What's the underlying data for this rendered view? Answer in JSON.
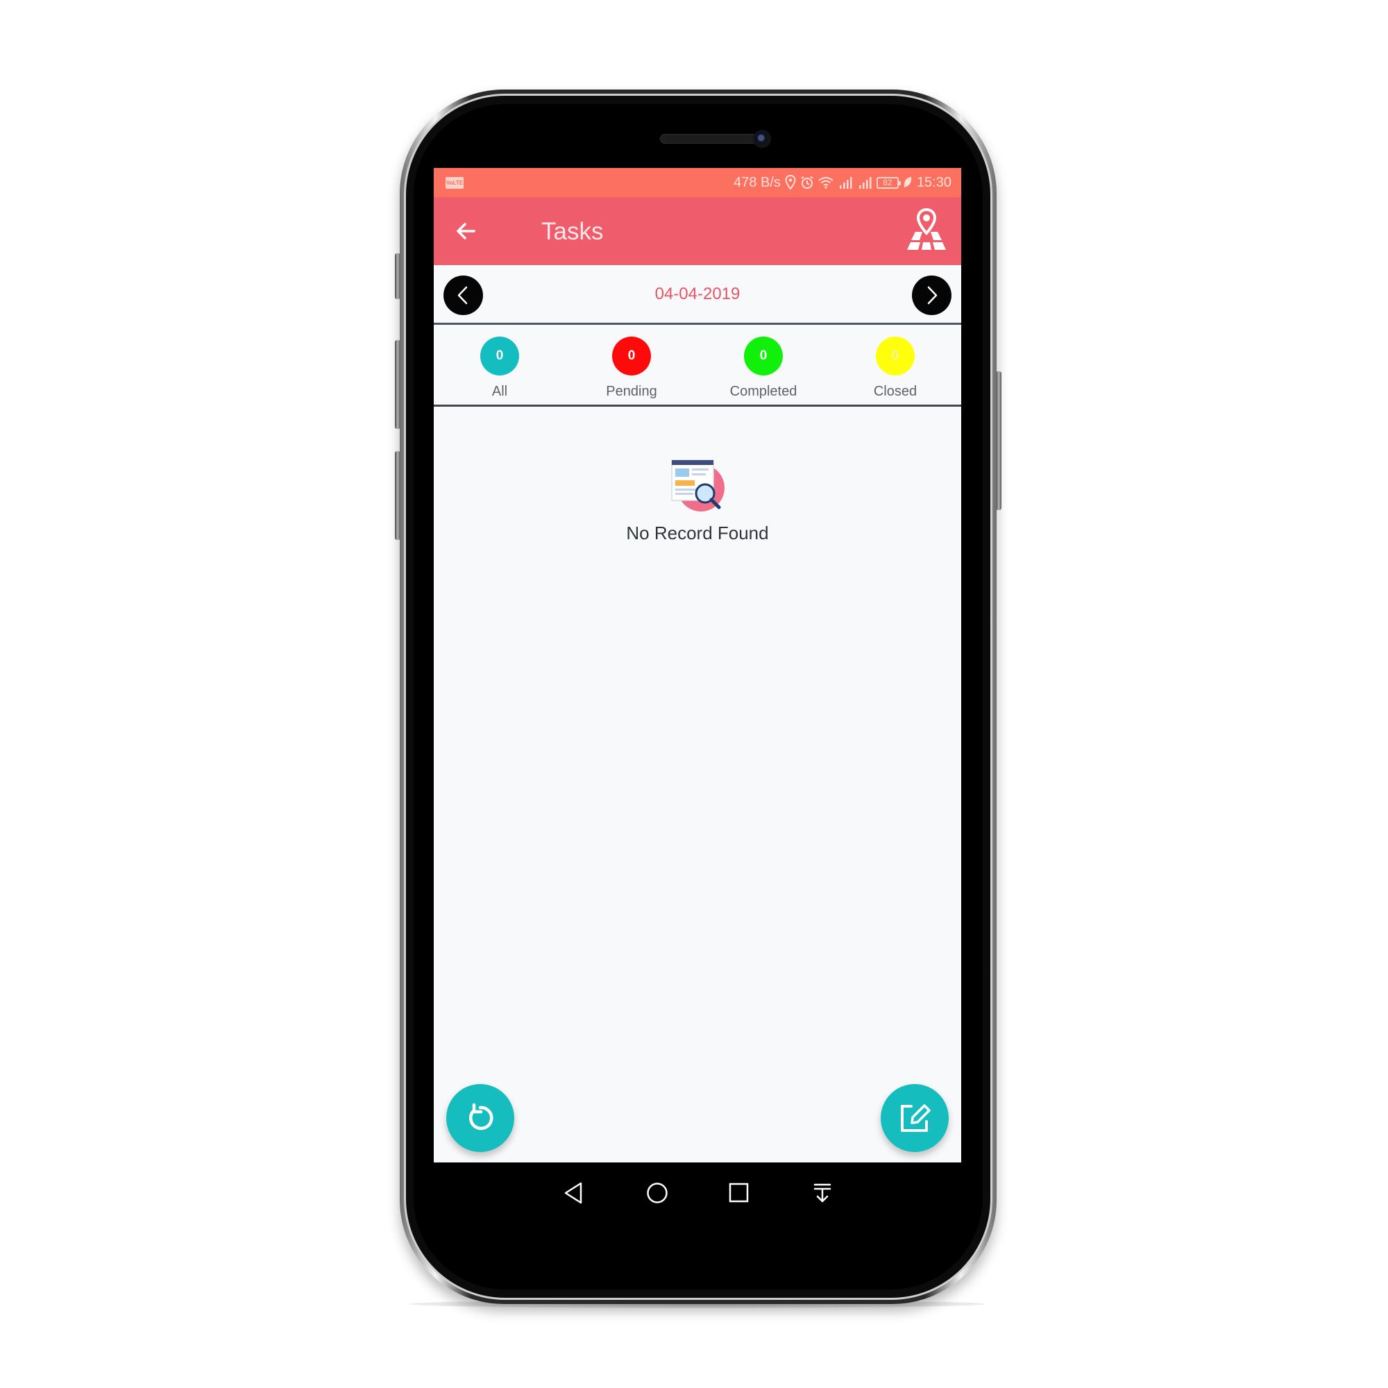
{
  "status_bar": {
    "volte": "VoLTE",
    "net_speed": "478 B/s",
    "battery": "82",
    "time": "15:30"
  },
  "app_bar": {
    "title": "Tasks",
    "back_icon": "arrow-left-icon",
    "action_icon": "map-location-icon"
  },
  "date_nav": {
    "date": "04-04-2019",
    "prev_icon": "chevron-left-icon",
    "next_icon": "chevron-right-icon"
  },
  "filters": [
    {
      "label": "All",
      "count": "0",
      "color": "#14bdc0"
    },
    {
      "label": "Pending",
      "count": "0",
      "color": "#ff0a0a"
    },
    {
      "label": "Completed",
      "count": "0",
      "color": "#10f00b"
    },
    {
      "label": "Closed",
      "count": "0",
      "color": "#ffff0b"
    }
  ],
  "empty_state": {
    "message": "No Record Found",
    "icon": "no-record-search-icon"
  },
  "fabs": {
    "refresh_icon": "refresh-icon",
    "edit_icon": "edit-icon",
    "color": "#16bdbf"
  },
  "system_nav": {
    "icons": [
      "back-triangle-icon",
      "home-circle-icon",
      "recents-square-icon",
      "notification-pull-icon"
    ]
  },
  "colors": {
    "status_bar": "#fb705e",
    "app_bar": "#ef5d6c",
    "date_text": "#e75463",
    "screen_bg": "#f8f9fa"
  }
}
